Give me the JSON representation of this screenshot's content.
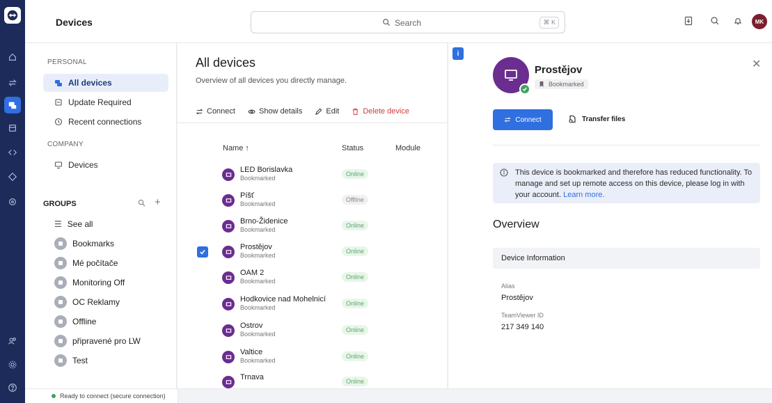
{
  "header": {
    "title": "Devices",
    "search_placeholder": "Search",
    "search_shortcut": "⌘ K",
    "avatar_initials": "MK"
  },
  "nav": {
    "personal_label": "PERSONAL",
    "personal_items": [
      "All devices",
      "Update Required",
      "Recent connections"
    ],
    "company_label": "COMPANY",
    "company_items": [
      "Devices"
    ],
    "groups_label": "GROUPS",
    "see_all": "See all",
    "groups": [
      "Bookmarks",
      "Mé počítače",
      "Monitoring Off",
      "OC Reklamy",
      "Offline",
      "připravené pro LW",
      "Test"
    ]
  },
  "main": {
    "title": "All devices",
    "subtitle": "Overview of all devices you directly manage.",
    "toolbar": {
      "connect": "Connect",
      "show_details": "Show details",
      "edit": "Edit",
      "delete": "Delete device"
    },
    "columns": {
      "name": "Name ↑",
      "status": "Status",
      "module": "Module"
    },
    "rows": [
      {
        "name": "LED Borislavka",
        "tag": "Bookmarked",
        "status": "Online"
      },
      {
        "name": "Píšť",
        "tag": "Bookmarked",
        "status": "Offline"
      },
      {
        "name": "Brno-Židenice",
        "tag": "Bookmarked",
        "status": "Online"
      },
      {
        "name": "Prostějov",
        "tag": "Bookmarked",
        "status": "Online"
      },
      {
        "name": "OAM 2",
        "tag": "Bookmarked",
        "status": "Online"
      },
      {
        "name": "Hodkovice nad Mohelnicí",
        "tag": "Bookmarked",
        "status": "Online"
      },
      {
        "name": "Ostrov",
        "tag": "Bookmarked",
        "status": "Online"
      },
      {
        "name": "Valtice",
        "tag": "Bookmarked",
        "status": "Online"
      },
      {
        "name": "Trnava",
        "tag": "",
        "status": "Online"
      }
    ]
  },
  "detail": {
    "name": "Prostějov",
    "badge": "Bookmarked",
    "connect": "Connect",
    "transfer": "Transfer files",
    "notice": "This device is bookmarked and therefore has reduced functionality. To manage and set up remote access on this device, please log in with your account.",
    "notice_link": "Learn more.",
    "overview": "Overview",
    "device_info": "Device Information",
    "alias_label": "Alias",
    "alias_value": "Prostějov",
    "tvid_label": "TeamViewer ID",
    "tvid_value": "217 349 140"
  },
  "statusbar": {
    "text": "Ready to connect (secure connection)"
  },
  "colors": {
    "rail": "#1c2b5a",
    "accent": "#2f6fe0",
    "device": "#6b2d8f",
    "online": "#3da35d"
  }
}
